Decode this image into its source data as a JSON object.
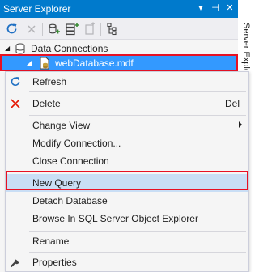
{
  "window": {
    "title": "Server Explorer",
    "buttons": {
      "dropdown": "▾",
      "pin": "⊣",
      "close": "✕"
    }
  },
  "side_tab": {
    "label": "Server Explorer"
  },
  "tree": {
    "data_connections": "Data Connections",
    "database": "webDatabase.mdf"
  },
  "context_menu": {
    "refresh": "Refresh",
    "delete": "Delete",
    "delete_shortcut": "Del",
    "change_view": "Change View",
    "modify_connection": "Modify Connection...",
    "close_connection": "Close Connection",
    "new_query": "New Query",
    "detach_database": "Detach Database",
    "browse_sql": "Browse In SQL Server Object Explorer",
    "rename": "Rename",
    "properties": "Properties"
  },
  "colors": {
    "accent": "#007acc",
    "selection": "#3399ff",
    "highlight_outline": "#e81123",
    "menu_hover": "#c9def5"
  }
}
